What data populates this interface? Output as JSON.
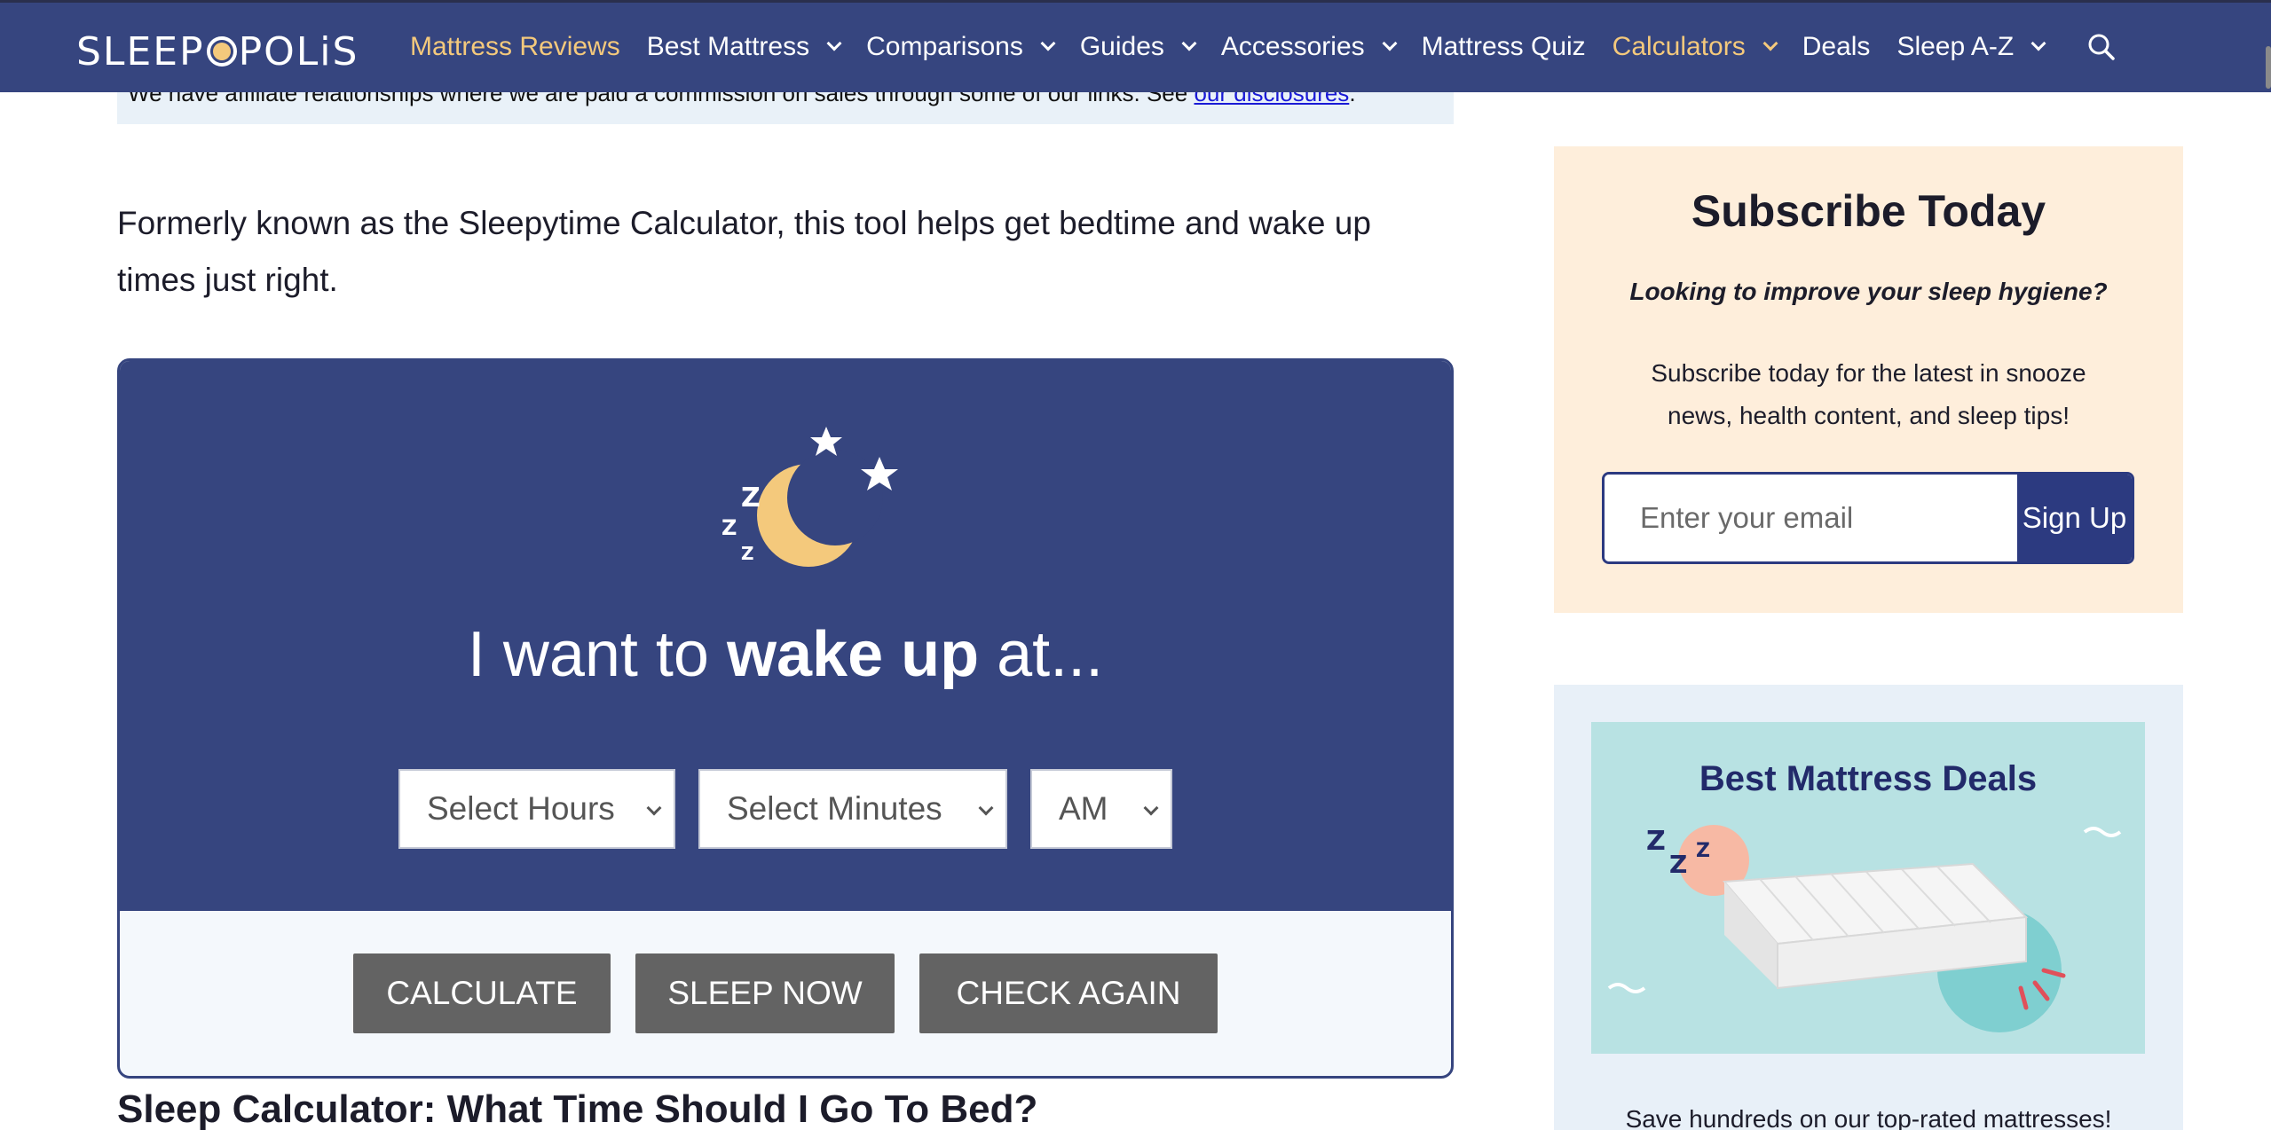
{
  "nav": {
    "logo": "SLEEPOPOLIS",
    "items": [
      {
        "label": "Mattress Reviews",
        "active": true,
        "has_dropdown": true
      },
      {
        "label": "Best Mattress",
        "active": false,
        "has_dropdown": true
      },
      {
        "label": "Comparisons",
        "active": false,
        "has_dropdown": true
      },
      {
        "label": "Guides",
        "active": false,
        "has_dropdown": true
      },
      {
        "label": "Accessories",
        "active": false,
        "has_dropdown": true
      },
      {
        "label": "Mattress Quiz",
        "active": false,
        "has_dropdown": false
      },
      {
        "label": "Calculators",
        "active": true,
        "has_dropdown": true
      },
      {
        "label": "Deals",
        "active": false,
        "has_dropdown": false
      },
      {
        "label": "Sleep A-Z",
        "active": false,
        "has_dropdown": true
      }
    ],
    "search_icon": "search-icon",
    "colors": {
      "bar": "#36457f",
      "highlight": "#f4c97c"
    }
  },
  "affiliate": {
    "text": "We have affiliate relationships where we are paid a commission on sales through some of our links. See ",
    "link": "our disclosures",
    "end": "."
  },
  "intro": "Formerly known as the Sleepytime Calculator, this tool helps get bedtime and wake up times just right.",
  "calculator": {
    "heading_pre": "I want to ",
    "heading_bold": "wake up",
    "heading_post": " at...",
    "icon": "moon-stars-zzz-icon",
    "selects": {
      "hours": "Select Hours",
      "minutes": "Select Minutes",
      "ampm": "AM"
    },
    "buttons": {
      "calculate": "CALCULATE",
      "sleep_now": "SLEEP NOW",
      "check_again": "CHECK AGAIN"
    }
  },
  "section_heading": "Sleep Calculator: What Time Should I Go To Bed?",
  "sidebar": {
    "subscribe": {
      "title": "Subscribe Today",
      "question": "Looking to improve your sleep hygiene?",
      "text": "Subscribe today for the latest in snooze news, health content, and sleep tips!",
      "email_placeholder": "Enter your email",
      "button": "Sign Up"
    },
    "deals": {
      "title": "Best Mattress Deals",
      "text": "Save hundreds on our top-rated mattresses!"
    }
  }
}
